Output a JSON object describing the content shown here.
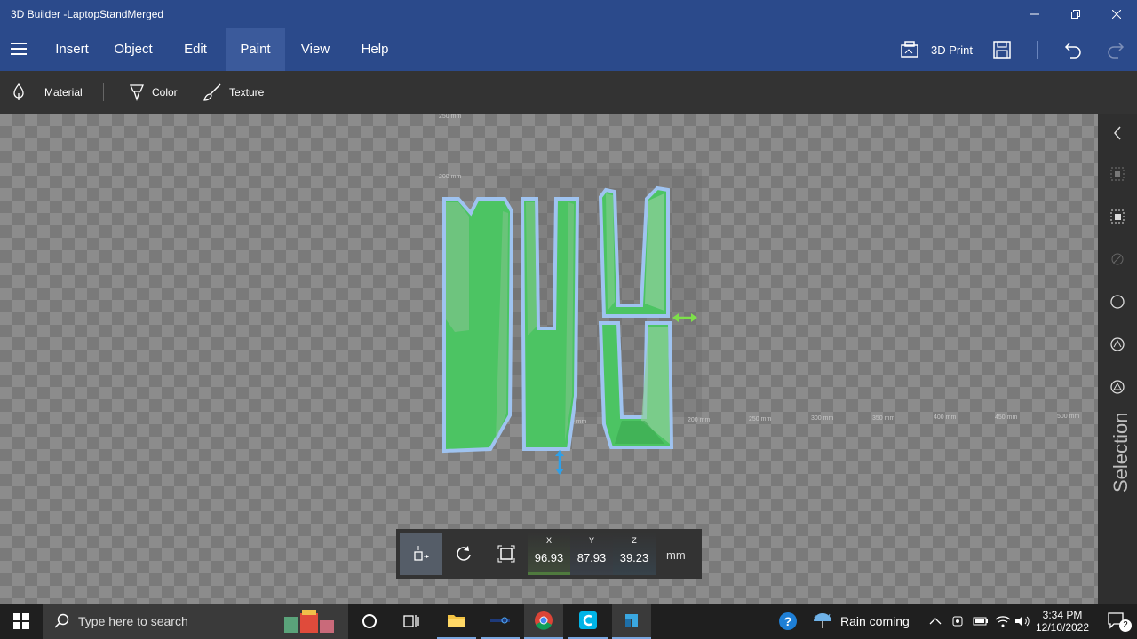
{
  "window": {
    "title": "3D Builder -LaptopStandMerged"
  },
  "menu": {
    "items": [
      "Insert",
      "Object",
      "Edit",
      "Paint",
      "View",
      "Help"
    ],
    "active": "Paint",
    "print_label": "3D Print"
  },
  "toolbar": {
    "material_label": "Material",
    "color_label": "Color",
    "texture_label": "Texture"
  },
  "grid_labels": {
    "y250": "250 mm",
    "y200": "200 mm",
    "x150": "150 mm",
    "x200": "200 mm",
    "x250": "250 mm",
    "x300": "300 mm",
    "x350": "350 mm",
    "x400": "400 mm",
    "x450": "450 mm",
    "x500": "500 mm"
  },
  "right_panel": {
    "label": "Selection"
  },
  "transform": {
    "x_label": "X",
    "y_label": "Y",
    "z_label": "Z",
    "x": "96.93",
    "y": "87.93",
    "z": "39.23",
    "unit": "mm"
  },
  "taskbar": {
    "search_placeholder": "Type here to search",
    "weather": "Rain coming",
    "time": "3:34 PM",
    "date": "12/10/2022",
    "notifications": "2"
  },
  "colors": {
    "titlebar": "#2b4a8b",
    "model_green": "#4cc463",
    "selection_outline": "#9fc3f0",
    "move_arrow_green": "#7de04a",
    "move_arrow_blue": "#2fa0e8"
  }
}
